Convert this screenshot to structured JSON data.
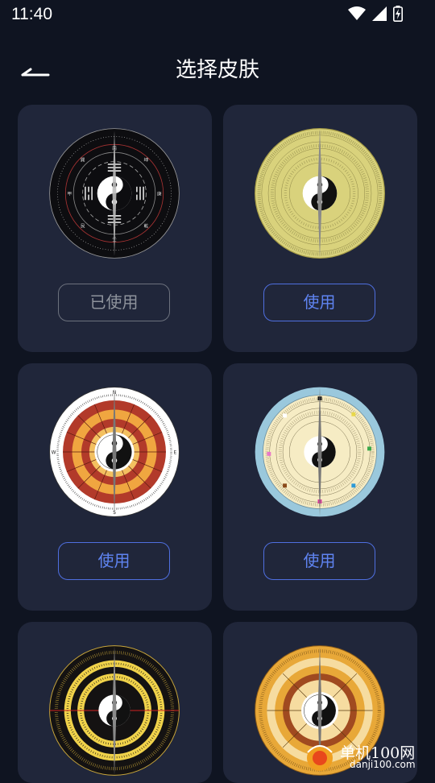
{
  "status_bar": {
    "time": "11:40",
    "icons": [
      "wifi-icon",
      "cellular-signal-icon",
      "battery-charging-icon"
    ]
  },
  "header": {
    "back_icon": "arrow-left-icon",
    "title": "选择皮肤"
  },
  "skins": [
    {
      "name": "black-bagua",
      "button_label": "已使用",
      "state": "used"
    },
    {
      "name": "yellow-luopan",
      "button_label": "使用",
      "state": "available"
    },
    {
      "name": "red-orange-compass",
      "button_label": "使用",
      "state": "available"
    },
    {
      "name": "light-blue-luopan",
      "button_label": "使用",
      "state": "available"
    },
    {
      "name": "black-gold-luopan",
      "button_label": "",
      "state": "available"
    },
    {
      "name": "gold-bagua-luopan",
      "button_label": "",
      "state": "available"
    }
  ],
  "watermark": {
    "brand": "单机100网",
    "url": "danji100.com"
  },
  "colors": {
    "background": "#0f1421",
    "card": "#20263a",
    "accent": "#5f84f2",
    "used": "#8e939c"
  }
}
